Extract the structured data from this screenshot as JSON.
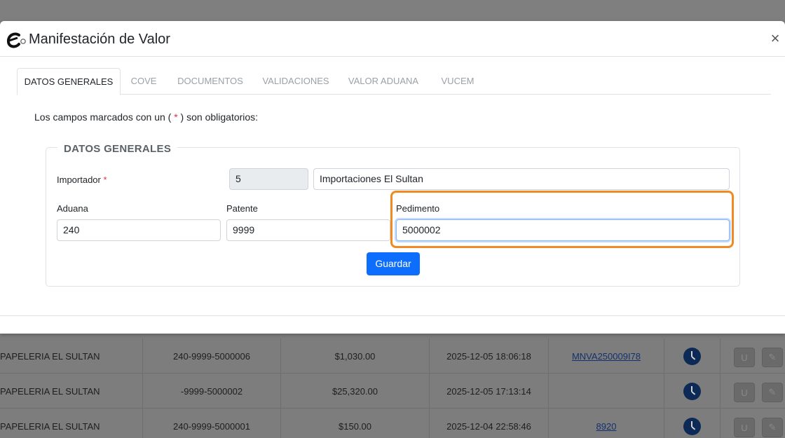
{
  "modal": {
    "title": "Manifestación de Valor",
    "close_label": "×"
  },
  "tabs": [
    {
      "label": "DATOS GENERALES",
      "active": true
    },
    {
      "label": "COVE",
      "active": false
    },
    {
      "label": "DOCUMENTOS",
      "active": false
    },
    {
      "label": "VALIDACIONES",
      "active": false
    },
    {
      "label": "VALOR ADUANA",
      "active": false
    },
    {
      "label": "VUCEM",
      "active": false
    }
  ],
  "form": {
    "required_note_prefix": "Los campos marcados con un ( ",
    "required_note_star": "*",
    "required_note_suffix": " ) son obligatorios:",
    "section_title": "DATOS GENERALES",
    "importador_label": "Importador",
    "importador_required": "*",
    "importador_id": "5",
    "importador_name": "Importaciones El Sultan",
    "aduana_label": "Aduana",
    "aduana_value": "240",
    "patente_label": "Patente",
    "patente_value": "9999",
    "pedimento_label": "Pedimento",
    "pedimento_value": "5000002",
    "save_label": "Guardar"
  },
  "background_table": {
    "rows": [
      {
        "cliente": "PAPELERIA EL SULTAN",
        "pedimento": "240-9999-5000006",
        "valor": "$1,030.00",
        "fecha": "2025-12-05 18:06:18",
        "cove": "MNVA250009I78"
      },
      {
        "cliente": "PAPELERIA EL SULTAN",
        "pedimento": "-9999-5000002",
        "valor": "$25,320.00",
        "fecha": "2025-12-05 17:13:14",
        "cove": ""
      },
      {
        "cliente": "PAPELERIA EL SULTAN",
        "pedimento": "240-9999-5000001",
        "valor": "$150.00",
        "fecha": "2025-12-04 22:58:46",
        "cove": "8920"
      }
    ],
    "btn_u_label": "U",
    "btn_edit_label": "✎"
  },
  "colors": {
    "primary": "#0d6efd",
    "highlight": "#f08a24",
    "required": "#dc3545"
  }
}
